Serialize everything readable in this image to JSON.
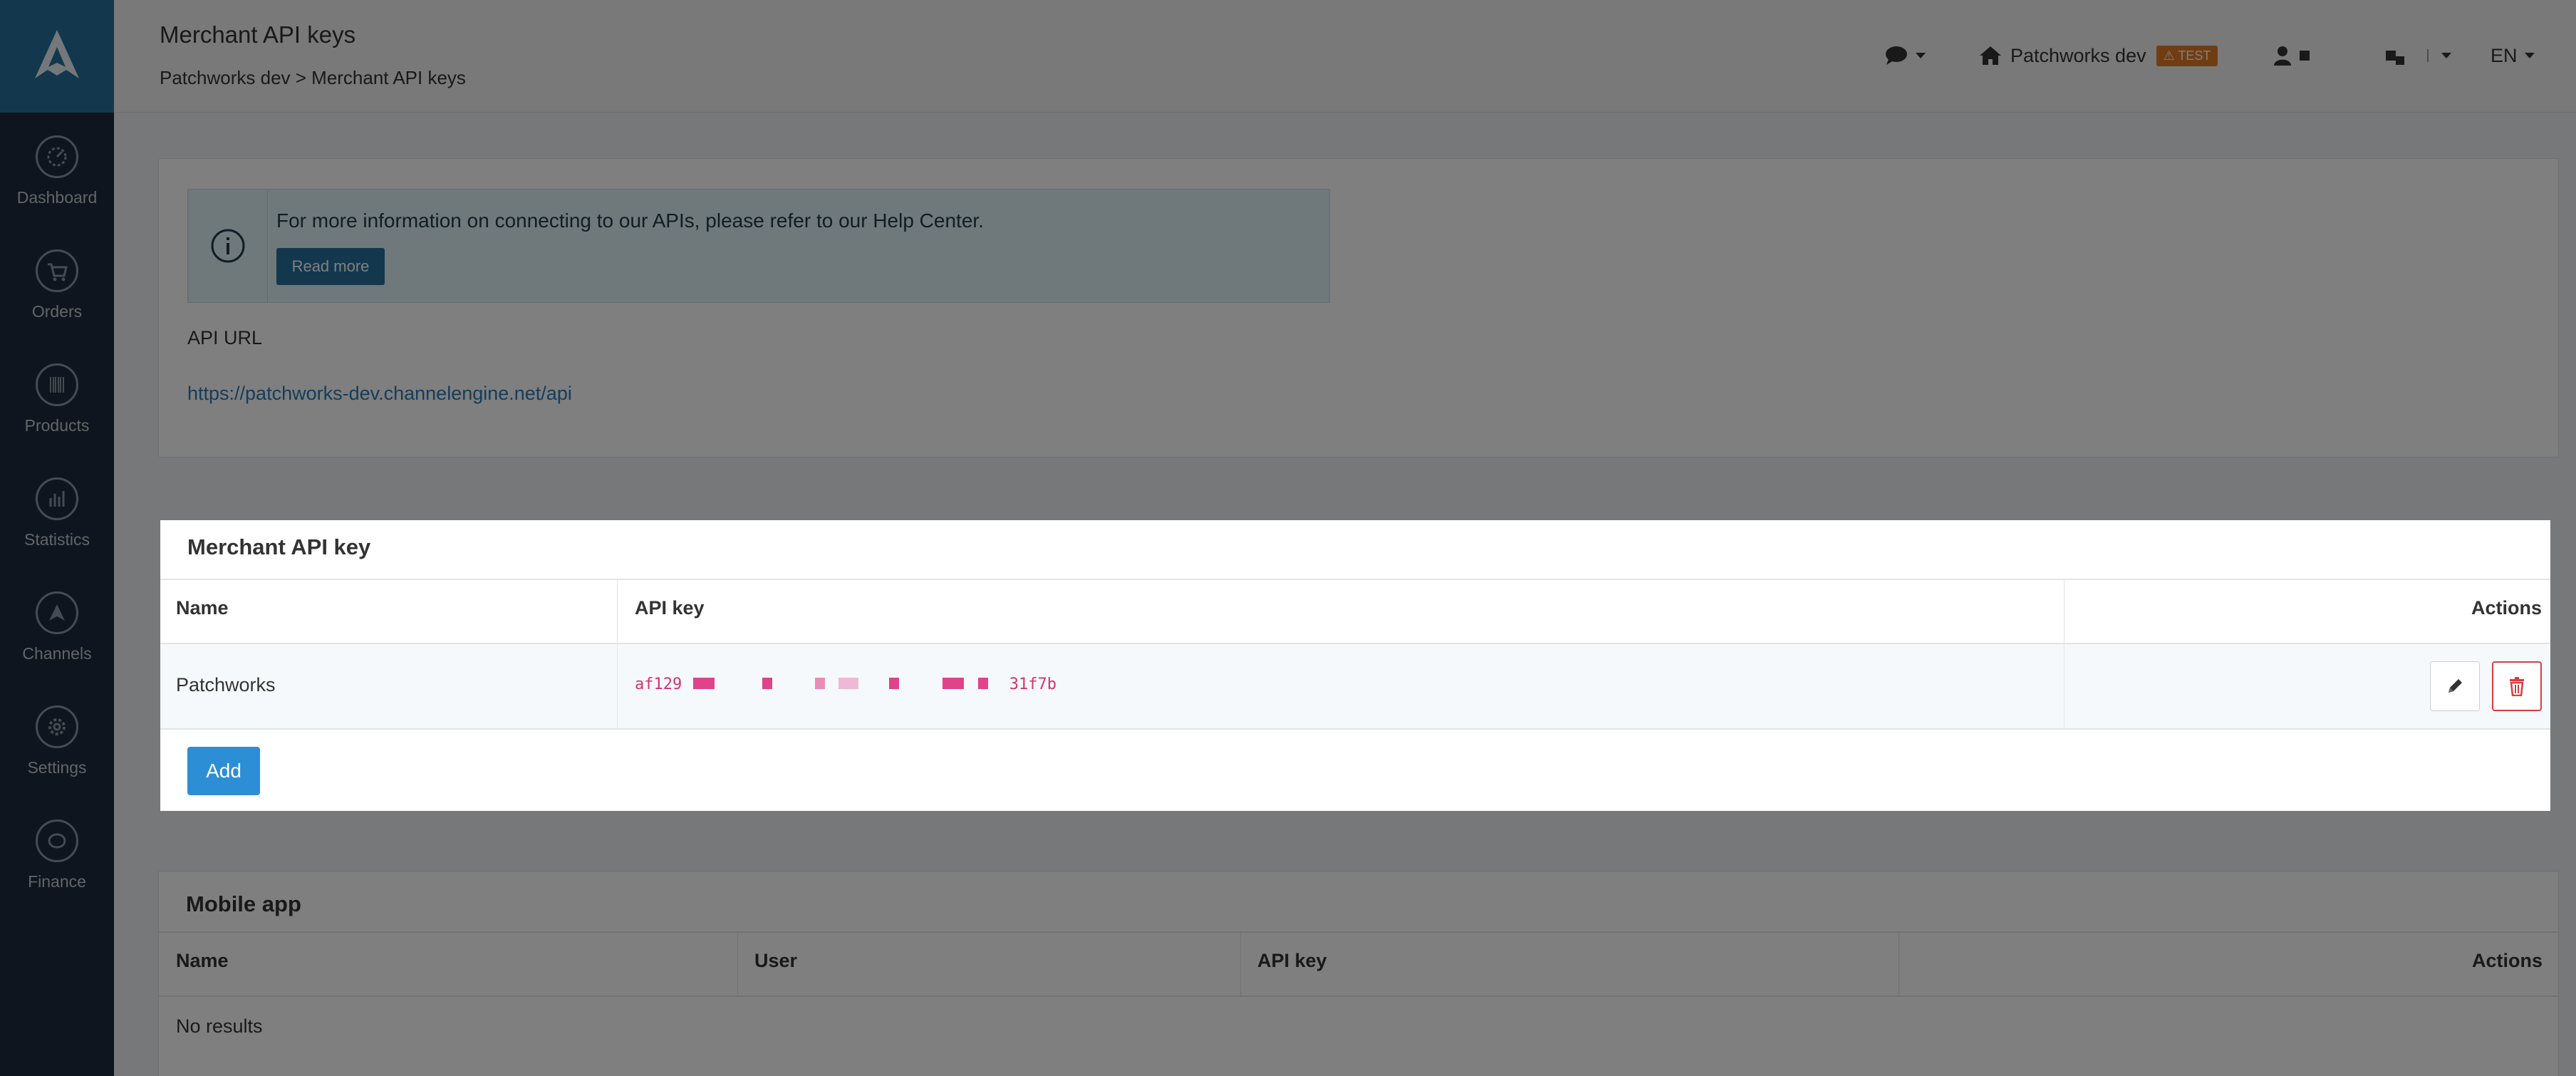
{
  "sidebar": {
    "logo_icon": "channelengine-logo",
    "items": [
      {
        "label": "Dashboard",
        "icon": "speedometer-icon"
      },
      {
        "label": "Orders",
        "icon": "cart-icon"
      },
      {
        "label": "Products",
        "icon": "barcode-icon"
      },
      {
        "label": "Statistics",
        "icon": "chart-icon"
      },
      {
        "label": "Channels",
        "icon": "channels-icon"
      },
      {
        "label": "Settings",
        "icon": "gear-icon"
      },
      {
        "label": "Finance",
        "icon": "coins-icon"
      }
    ]
  },
  "header": {
    "title": "Merchant API keys",
    "breadcrumb": "Patchworks dev > Merchant API keys",
    "store_name": "Patchworks dev",
    "env_badge": "TEST",
    "language": "EN"
  },
  "info": {
    "alert_text": "For more information on connecting to our APIs, please refer to our Help Center.",
    "read_more": "Read more",
    "api_url_label": "API URL",
    "api_url": "https://patchworks-dev.channelengine.net/api"
  },
  "merchant_keys": {
    "title": "Merchant API key",
    "columns": {
      "name": "Name",
      "api_key": "API key",
      "actions": "Actions"
    },
    "rows": [
      {
        "name": "Patchworks",
        "key_start": "af129",
        "key_end": "31f7b"
      }
    ],
    "add_label": "Add"
  },
  "mobile_app": {
    "title": "Mobile app",
    "columns": {
      "name": "Name",
      "user": "User",
      "api_key": "API key",
      "actions": "Actions"
    },
    "empty": "No results"
  },
  "colors": {
    "sidebar": "#1e2a3c",
    "logo_bg": "#27709c",
    "primary": "#2c8fd6",
    "danger": "#e03b3b",
    "badge": "#e07b24",
    "key_text": "#d6336c"
  }
}
